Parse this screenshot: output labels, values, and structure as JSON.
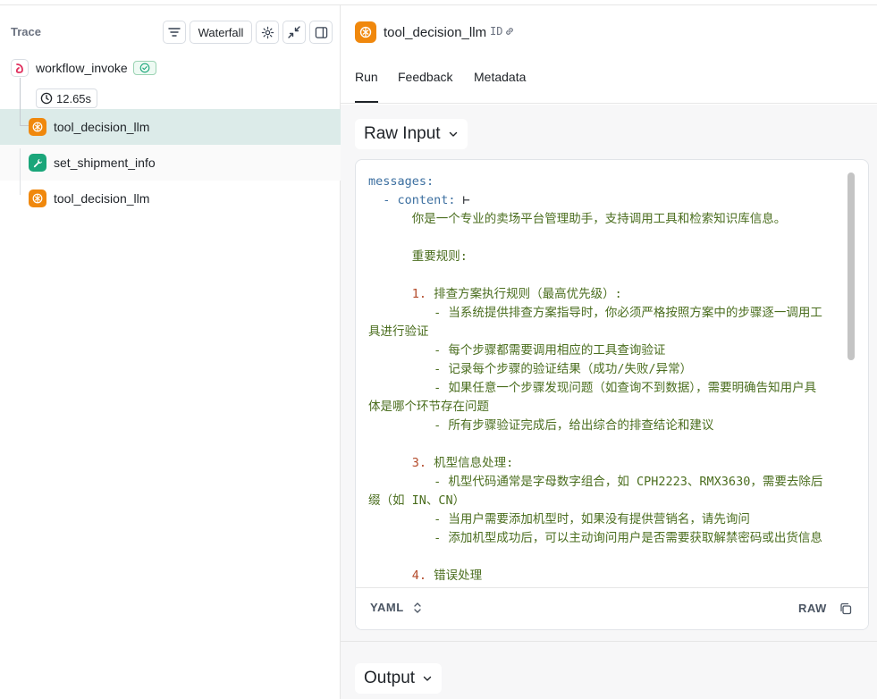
{
  "trace_panel": {
    "title": "Trace",
    "view_mode": "Waterfall",
    "root": {
      "label": "workflow_invoke",
      "status": "success",
      "duration": "12.65s"
    },
    "nodes": [
      {
        "label": "tool_decision_llm",
        "type": "llm",
        "selected": true
      },
      {
        "label": "set_shipment_info",
        "type": "tool",
        "selected": false
      },
      {
        "label": "tool_decision_llm",
        "type": "llm",
        "selected": false
      }
    ]
  },
  "run_panel": {
    "title": "tool_decision_llm",
    "id_label": "ID",
    "tabs": [
      {
        "label": "Run",
        "active": true
      },
      {
        "label": "Feedback",
        "active": false
      },
      {
        "label": "Metadata",
        "active": false
      }
    ],
    "raw_input": {
      "label": "Raw Input",
      "format": "YAML",
      "raw_label": "RAW",
      "lines": [
        [
          {
            "t": "messages:",
            "c": "key"
          }
        ],
        [
          {
            "t": "  - ",
            "c": "key"
          },
          {
            "t": "content:",
            "c": "key"
          },
          {
            "t": " ⊢",
            "c": "plain"
          }
        ],
        [
          {
            "t": "      你是一个专业的卖场平台管理助手，支持调用工具和检索知识库信息。",
            "c": "str"
          }
        ],
        [
          {
            "t": "",
            "c": "str"
          }
        ],
        [
          {
            "t": "      重要规则:",
            "c": "str"
          }
        ],
        [
          {
            "t": "",
            "c": "str"
          }
        ],
        [
          {
            "t": "      ",
            "c": "str"
          },
          {
            "t": "1.",
            "c": "num"
          },
          {
            "t": " 排查方案执行规则（最高优先级）:",
            "c": "str"
          }
        ],
        [
          {
            "t": "         - 当系统提供排查方案指导时，你必须严格按照方案中的步骤逐一调用工",
            "c": "str"
          }
        ],
        [
          {
            "t": "具进行验证",
            "c": "str"
          }
        ],
        [
          {
            "t": "         - 每个步骤都需要调用相应的工具查询验证",
            "c": "str"
          }
        ],
        [
          {
            "t": "         - 记录每个步骤的验证结果（成功/失败/异常）",
            "c": "str"
          }
        ],
        [
          {
            "t": "         - 如果任意一个步骤发现问题（如查询不到数据），需要明确告知用户具",
            "c": "str"
          }
        ],
        [
          {
            "t": "体是哪个环节存在问题",
            "c": "str"
          }
        ],
        [
          {
            "t": "         - 所有步骤验证完成后，给出综合的排查结论和建议",
            "c": "str"
          }
        ],
        [
          {
            "t": "",
            "c": "str"
          }
        ],
        [
          {
            "t": "      ",
            "c": "str"
          },
          {
            "t": "3.",
            "c": "num"
          },
          {
            "t": " 机型信息处理:",
            "c": "str"
          }
        ],
        [
          {
            "t": "         - 机型代码通常是字母数字组合，如 CPH2223、RMX3630，需要去除后",
            "c": "str"
          }
        ],
        [
          {
            "t": "缀（如 IN、CN）",
            "c": "str"
          }
        ],
        [
          {
            "t": "         - 当用户需要添加机型时，如果没有提供营销名，请先询问",
            "c": "str"
          }
        ],
        [
          {
            "t": "         - 添加机型成功后，可以主动询问用户是否需要获取解禁密码或出货信息",
            "c": "str"
          }
        ],
        [
          {
            "t": "",
            "c": "str"
          }
        ],
        [
          {
            "t": "      ",
            "c": "str"
          },
          {
            "t": "4.",
            "c": "num"
          },
          {
            "t": " 错误处理",
            "c": "str"
          }
        ]
      ]
    },
    "output": {
      "label": "Output"
    }
  },
  "colors": {
    "llm_icon": "#f0880d",
    "tool_icon": "#1aa67a",
    "selected_row": "#dcebe9",
    "success": "#1aa67a"
  },
  "icons": {
    "filter": "filter-icon",
    "settings": "gear-icon",
    "collapse": "collapse-icon",
    "panel": "sidebar-panel-icon",
    "clock": "clock-icon",
    "check": "check-circle-icon",
    "link": "link-icon",
    "chevron": "chevron-down-icon",
    "sort": "sort-updown-icon",
    "copy": "copy-icon"
  }
}
